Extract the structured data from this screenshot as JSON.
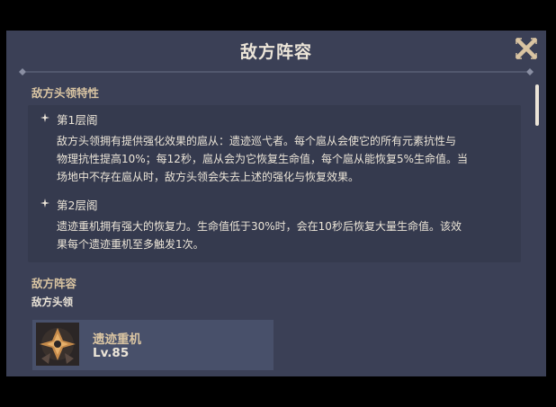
{
  "dialog": {
    "title": "敌方阵容",
    "close_icon": "close-x-icon"
  },
  "traits": {
    "heading": "敌方头领特性",
    "layers": [
      {
        "title": "第1层阁",
        "lines": [
          "敌方头领拥有提供强化效果的扈从：遗迹巡弋者。每个扈从会使它的所有元素抗性与",
          "物理抗性提高10%；每12秒，扈从会为它恢复生命值，每个扈从能恢复5%生命值。当",
          "场地中不存在扈从时，敌方头领会失去上述的强化与恢复效果。"
        ]
      },
      {
        "title": "第2层阁",
        "lines": [
          "遗迹重机拥有强大的恢复力。生命值低于30%时，会在10秒后恢复大量生命值。该效",
          "果每个遗迹重机至多触发1次。"
        ]
      }
    ]
  },
  "lineup": {
    "heading": "敌方阵容",
    "subheading": "敌方头领",
    "boss": {
      "name": "遗迹重机",
      "level": "Lv.85",
      "icon": "ruin-grader-portrait"
    }
  },
  "colors": {
    "panel": "#3b4056",
    "text": "#ece5d8",
    "accent": "#d9c4a2"
  }
}
